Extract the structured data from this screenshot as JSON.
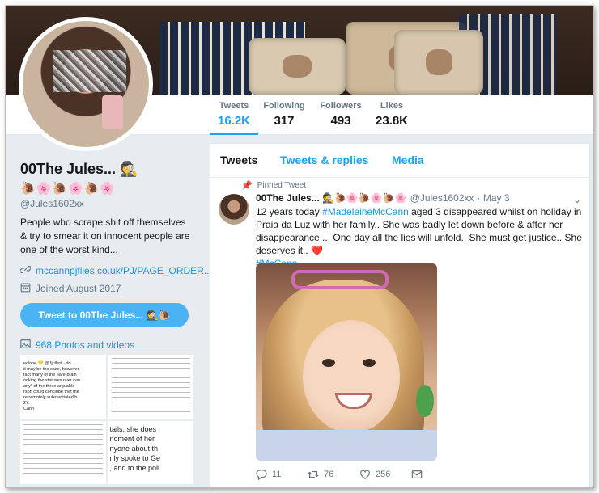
{
  "profile": {
    "name": "00The Jules... 🕵️",
    "emoji_row": "🐌🌸🐌🌸🐌🌸",
    "handle": "@Jules1602xx",
    "bio": "People who scrape shit off themselves & try to smear it on innocent people are one of the worst kind...",
    "link": "mccannpjfiles.co.uk/PJ/PAGE_ORDER....",
    "joined": "Joined August 2017",
    "tweet_button": "Tweet to 00The Jules... 🕵️🐌",
    "photos_label": "968 Photos and videos"
  },
  "stats": [
    {
      "label": "Tweets",
      "value": "16.2K"
    },
    {
      "label": "Following",
      "value": "317"
    },
    {
      "label": "Followers",
      "value": "493"
    },
    {
      "label": "Likes",
      "value": "23.8K"
    }
  ],
  "tabs": [
    "Tweets",
    "Tweets & replies",
    "Media"
  ],
  "tweet": {
    "pinned_label": "Pinned Tweet",
    "name": "00The Jules... 🕵️🐌🌸🐌🌸🐌🌸",
    "handle": "@Jules1602xx",
    "date": "· May 3",
    "text_1": "12 years today ",
    "hashtag_1": "#MadeleineMcCann",
    "text_2": " aged 3 disappeared whilst on holiday in Praia da Luz with her family.. She was badly let down before & after her disappearance ... One day all the lies will unfold.. She must get justice.. She deserves it.. ❤️",
    "hashtag_2": "#McCann",
    "replies": "11",
    "retweets": "76",
    "likes": "256"
  },
  "thumb_text": {
    "t1": "eclone 💛 @Jjullert · dd\nit may be the case, however,\nfact many of the hare-brain\nooking the statuses over can\nany* of the three arguable\nrson could conclude that the\nre remotely substantiated b\n27.\nCann",
    "t4": "tails, she does\nnoment of her\nnyone about th\nnly spoke to Ge\n, and to the poli"
  }
}
